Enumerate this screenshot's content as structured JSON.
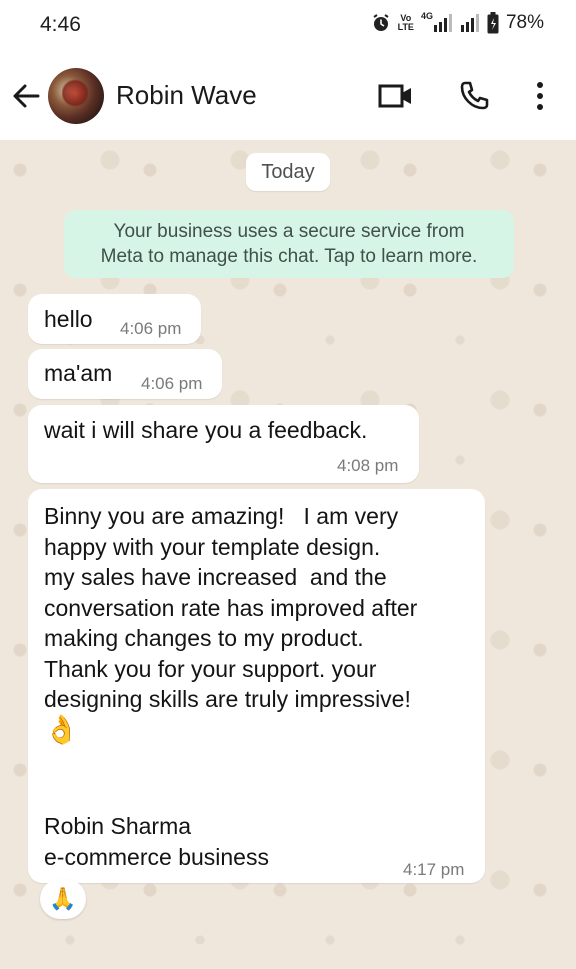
{
  "status_bar": {
    "time": "4:46",
    "volte_label": "Vo\nLTE",
    "network_label": "4G",
    "battery": "78%",
    "icons": [
      "alarm-icon",
      "volte-icon",
      "signal-icon",
      "signal-icon",
      "battery-icon"
    ]
  },
  "header": {
    "contact_name": "Robin Wave",
    "icons": [
      "back-arrow-icon",
      "video-call-icon",
      "phone-icon",
      "more-icon"
    ]
  },
  "chat": {
    "date_chip": "Today",
    "system_message": "Your business uses a secure service from\nMeta to manage this chat. Tap to learn more.",
    "messages": [
      {
        "text": "hello",
        "time": "4:06 pm"
      },
      {
        "text": "ma'am",
        "time": "4:06 pm"
      },
      {
        "text": "wait i will share you a feedback.",
        "time": "4:08 pm"
      },
      {
        "text": "Binny you are amazing!   I am very\nhappy with your template design.\nmy sales have increased  and the\nconversation rate has improved after\nmaking changes to my product.\nThank you for your support. your\ndesigning skills are truly impressive!",
        "emoji": "👌",
        "signature": "Robin Sharma\ne-commerce business",
        "time": "4:17 pm"
      }
    ],
    "reaction": "🙏"
  },
  "colors": {
    "header_bg": "#ffffff",
    "chat_bg": "#efe7dc",
    "system_bubble": "#d7f5e6",
    "bubble": "#ffffff",
    "time_text": "#7a7a7a"
  }
}
